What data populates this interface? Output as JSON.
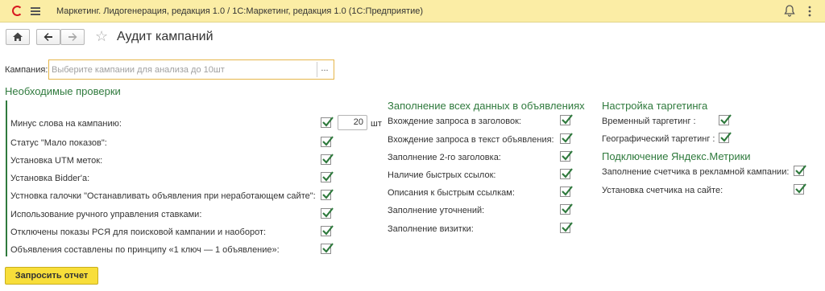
{
  "app": {
    "logo_text": "1С",
    "title": "Маркетинг. Лидогенерация, редакция 1.0 / 1С:Маркетинг, редакция 1.0   (1С:Предприятие)"
  },
  "nav": {
    "home_icon": "home-icon",
    "back_icon": "arrow-left-icon",
    "forward_icon": "arrow-right-icon"
  },
  "page": {
    "title": "Аудит кампаний"
  },
  "campaign": {
    "label": "Кампания:",
    "placeholder": "Выберите кампании для анализа до 10шт",
    "value": "",
    "select_label": "..."
  },
  "required": {
    "title": "Необходимые проверки",
    "minus_qty": "20",
    "minus_unit": "шт",
    "items": [
      {
        "label": "Минус слова на кампанию:",
        "checked": true
      },
      {
        "label": "Статус \"Мало показов\":",
        "checked": true
      },
      {
        "label": "Установка UTM меток:",
        "checked": true
      },
      {
        "label": "Установка Bidder'a:",
        "checked": true
      },
      {
        "label": "Устновка галочки \"Останавливать объявления при неработающем сайте\":",
        "checked": true
      },
      {
        "label": "Использование ручного управления ставками:",
        "checked": true
      },
      {
        "label": "Отключены показы РСЯ для поисковой кампании и наоборот:",
        "checked": true
      },
      {
        "label": "Объявления составлены по принципу «1 ключ — 1 объявление»:",
        "checked": true
      }
    ]
  },
  "ads_data": {
    "title": "Заполнение всех данных в объявлениях",
    "items": [
      {
        "label": "Вхождение запроса в заголовок:",
        "checked": true
      },
      {
        "label": "Вхождение запроса в текст объявления:",
        "checked": true
      },
      {
        "label": "Заполнение 2-го заголовка:",
        "checked": true
      },
      {
        "label": "Наличие быстрых ссылок:",
        "checked": true
      },
      {
        "label": "Описания к быстрым ссылкам:",
        "checked": true
      },
      {
        "label": "Заполнение уточнений:",
        "checked": true
      },
      {
        "label": "Заполнение визитки:",
        "checked": true
      }
    ]
  },
  "targeting": {
    "title": "Настройка таргетинга",
    "items": [
      {
        "label": "Временный таргетинг :",
        "checked": true
      },
      {
        "label": "Географический таргетинг :",
        "checked": true
      }
    ]
  },
  "metrika": {
    "title": "Подключение Яндекс.Метрики",
    "items": [
      {
        "label": "Заполнение счетчика в рекламной кампании:",
        "checked": true
      },
      {
        "label": "Установка счетчика на сайте:",
        "checked": true
      }
    ]
  },
  "actions": {
    "submit_label": "Запросить отчет"
  },
  "colors": {
    "accent_green": "#2f7a3d",
    "titlebar": "#fbeda5",
    "button_yellow": "#f8de3a",
    "focus_border": "#e6b64a"
  }
}
